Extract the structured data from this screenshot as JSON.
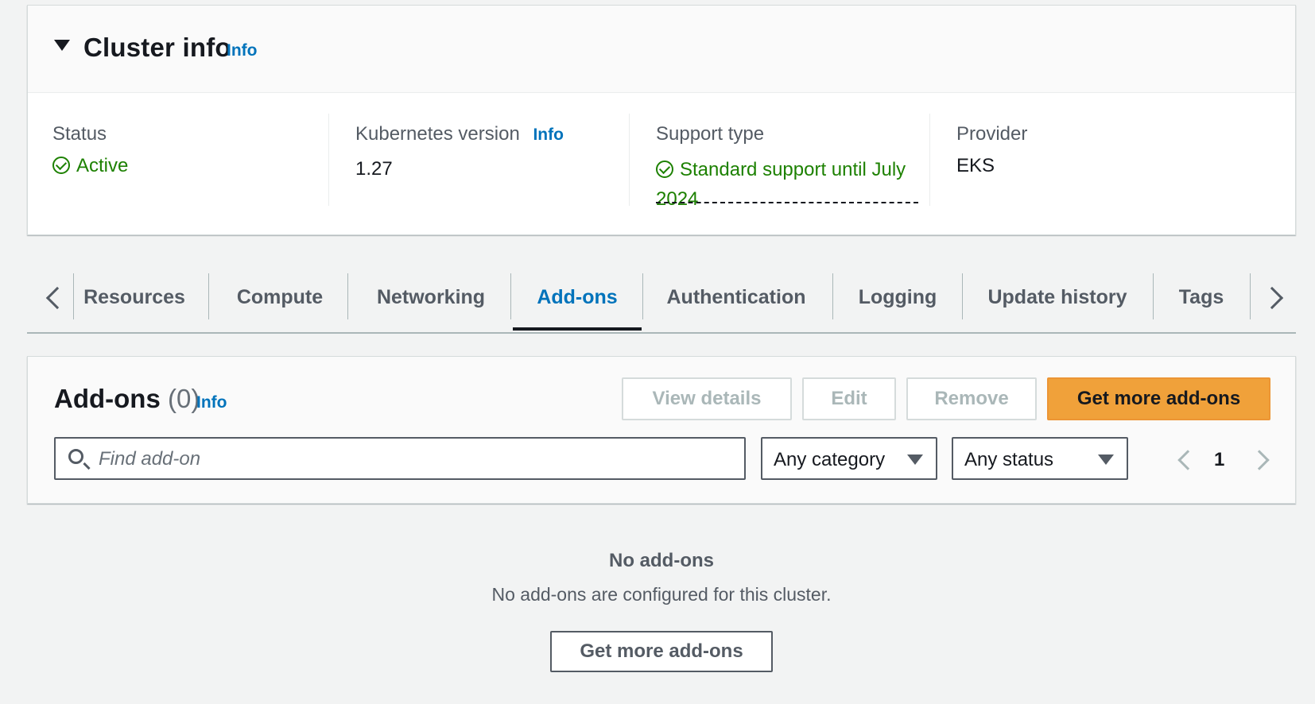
{
  "cluster_info": {
    "title": "Cluster info",
    "info_link": "Info",
    "status_label": "Status",
    "status_value": "Active",
    "k8s_label": "Kubernetes version",
    "k8s_info_link": "Info",
    "k8s_value": "1.27",
    "support_label": "Support type",
    "support_value": "Standard support until July 2024",
    "provider_label": "Provider",
    "provider_value": "EKS"
  },
  "tabs": [
    {
      "label": "Resources"
    },
    {
      "label": "Compute"
    },
    {
      "label": "Networking"
    },
    {
      "label": "Add-ons",
      "active": true
    },
    {
      "label": "Authentication"
    },
    {
      "label": "Logging"
    },
    {
      "label": "Update history"
    },
    {
      "label": "Tags"
    }
  ],
  "addons": {
    "title": "Add-ons",
    "count": "(0)",
    "info_link": "Info",
    "view_details": "View details",
    "edit": "Edit",
    "remove": "Remove",
    "get_more": "Get more add-ons",
    "search_placeholder": "Find add-on",
    "category_select": "Any category",
    "status_select": "Any status",
    "page": "1"
  },
  "empty_state": {
    "title": "No add-ons",
    "description": "No add-ons are configured for this cluster.",
    "button": "Get more add-ons"
  },
  "colors": {
    "link": "#0073bb",
    "success": "#1d8102",
    "primary_button": "#f0a13a"
  }
}
